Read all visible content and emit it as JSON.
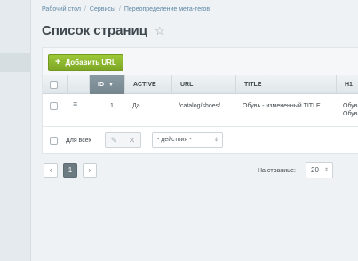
{
  "breadcrumb": [
    "Рабочий стол",
    "Сервисы",
    "Переопределение мета-тегов"
  ],
  "page_title": "Список страниц",
  "toolbar": {
    "add_label": "Добавить URL"
  },
  "table": {
    "columns": [
      "ID",
      "ACTIVE",
      "URL",
      "TITLE",
      "H1"
    ],
    "sorted_column": "ID",
    "rows": [
      {
        "id": "1",
        "active": "Да",
        "url": "/catalog/shoes/",
        "title": "Обувь - измененный TITLE",
        "h1": "Обув Обув"
      }
    ]
  },
  "footer": {
    "select_all_label": "Для всех",
    "actions_placeholder": "- действия -"
  },
  "pagination": {
    "prev": "‹",
    "next": "›",
    "current_page": "1",
    "per_page_label": "На странице:",
    "per_page_value": "20"
  }
}
